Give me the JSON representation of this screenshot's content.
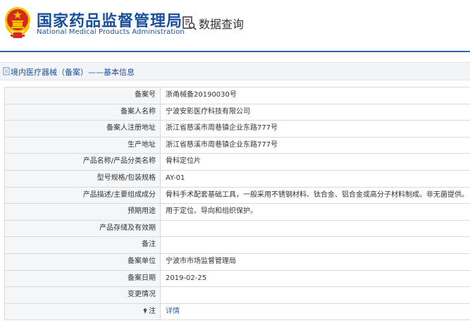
{
  "header": {
    "agency_cn": "国家药品监督管理局",
    "agency_en": "National Medical Products Administration",
    "query_title": "数据查询"
  },
  "breadcrumb": {
    "text": "境内医疗器械（备案）——基本信息"
  },
  "rows": [
    {
      "label": "备案号",
      "value": "浙甬械备20190030号"
    },
    {
      "label": "备案人名称",
      "value": "宁波安影医疗科技有限公司"
    },
    {
      "label": "备案人注册地址",
      "value": "浙江省慈溪市周巷镇企业东路777号"
    },
    {
      "label": "生产地址",
      "value": "浙江省慈溪市周巷镇企业东路777号"
    },
    {
      "label": "产品名称/产品分类名称",
      "value": "骨科定位片"
    },
    {
      "label": "型号规格/包装规格",
      "value": "AY-01"
    },
    {
      "label": "产品描述/主要组成成分",
      "value": "骨科手术配套基础工具，一般采用不锈钢材料、钛合金、铝合金或高分子材料制成。非无菌提供。"
    },
    {
      "label": "预期用途",
      "value": "用于定位、导向和组织保护。"
    },
    {
      "label": "产品存储及有效期",
      "value": ""
    },
    {
      "label": "备注",
      "value": ""
    },
    {
      "label": "备案单位",
      "value": "宁波市市场监督管理局"
    },
    {
      "label": "备案日期",
      "value": "2019-02-25"
    },
    {
      "label": "变更情况",
      "value": ""
    },
    {
      "label": "注",
      "value": "详情"
    }
  ],
  "colors": {
    "brand_blue": "#1a4f9c",
    "emblem_red": "#d42a1e",
    "emblem_gold": "#f5c400",
    "link_blue": "#2a66b0"
  },
  "icons": {
    "emblem": "national-emblem-icon",
    "query": "search-document-icon",
    "breadcrumb": "document-icon",
    "note": "pin-icon"
  }
}
